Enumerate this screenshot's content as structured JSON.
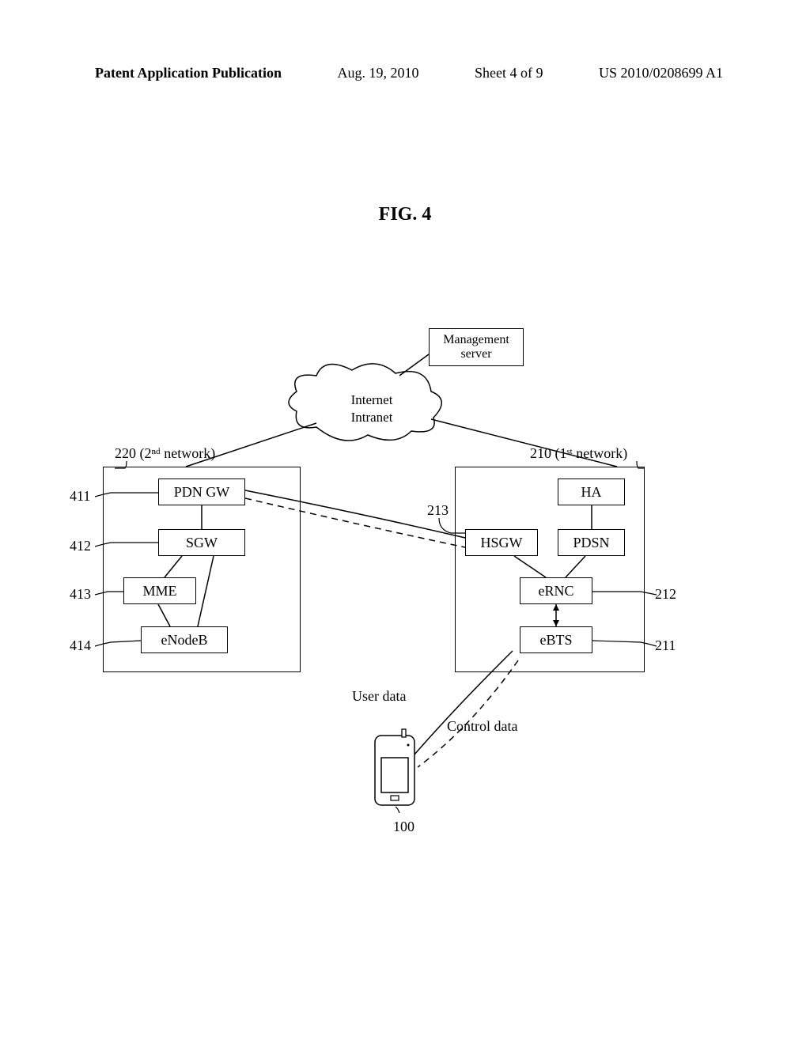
{
  "header": {
    "left": "Patent Application Publication",
    "date": "Aug. 19, 2010",
    "sheet": "Sheet 4 of 9",
    "pubno": "US 2010/0208699 A1"
  },
  "figure": {
    "title": "FIG. 4"
  },
  "nodes": {
    "mgmt_line1": "Management",
    "mgmt_line2": "server",
    "cloud_line1": "Internet",
    "cloud_line2": "Intranet",
    "pdn_gw": "PDN GW",
    "sgw": "SGW",
    "mme": "MME",
    "enodeb": "eNodeB",
    "ha": "HA",
    "hsgw": "HSGW",
    "pdsn": "PDSN",
    "ernc": "eRNC",
    "ebts": "eBTS"
  },
  "refs": {
    "r411": "411",
    "r412": "412",
    "r413": "413",
    "r414": "414",
    "r213": "213",
    "r212": "212",
    "r211": "211",
    "r220_num": "220",
    "r220_txt": "(2ⁿᵈ network)",
    "r210_num": "210",
    "r210_txt": "(1ˢᵗ network)",
    "r100": "100"
  },
  "legend": {
    "user_data": "User data",
    "control_data": "Control data"
  }
}
